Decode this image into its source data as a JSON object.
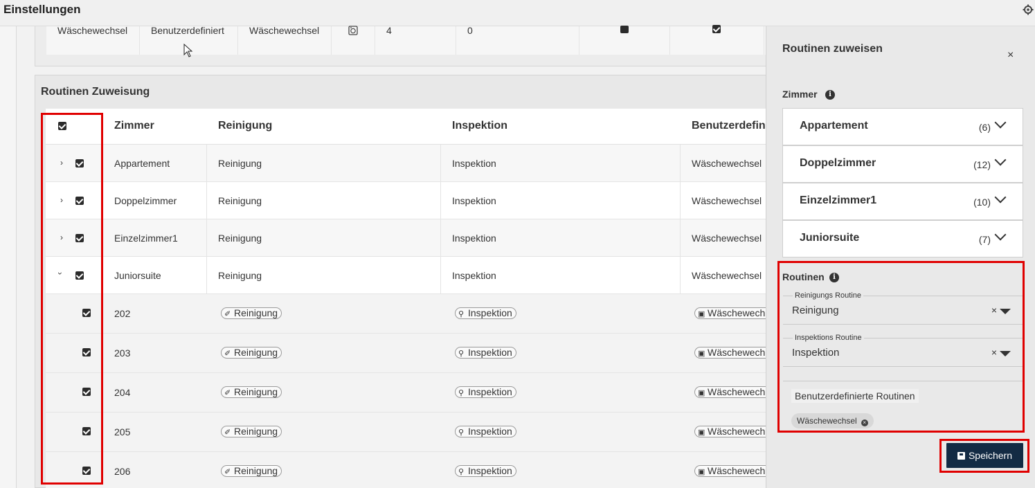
{
  "header": {
    "title": "Einstellungen",
    "settings_icon": "gear-icon"
  },
  "top_row": {
    "cells": [
      "Wäschewechsel",
      "Benutzerdefiniert",
      "Wäschewechsel",
      "4",
      "0"
    ],
    "icon": "laundry-icon"
  },
  "assignment": {
    "title": "Routinen Zuweisung",
    "columns": [
      "Zimmer",
      "Reinigung",
      "Inspektion",
      "Benutzerdefini"
    ],
    "groups": [
      {
        "name": "Appartement",
        "reinigung": "Reinigung",
        "inspektion": "Inspektion",
        "custom": "Wäschewechsel",
        "expanded": false
      },
      {
        "name": "Doppelzimmer",
        "reinigung": "Reinigung",
        "inspektion": "Inspektion",
        "custom": "Wäschewechsel",
        "expanded": false
      },
      {
        "name": "Einzelzimmer1",
        "reinigung": "Reinigung",
        "inspektion": "Inspektion",
        "custom": "Wäschewechsel",
        "expanded": false
      },
      {
        "name": "Juniorsuite",
        "reinigung": "Reinigung",
        "inspektion": "Inspektion",
        "custom": "Wäschewechsel",
        "expanded": true
      }
    ],
    "rooms": [
      {
        "number": "202",
        "reinigung": "Reinigung",
        "inspektion": "Inspektion",
        "custom": "Wäschewech"
      },
      {
        "number": "203",
        "reinigung": "Reinigung",
        "inspektion": "Inspektion",
        "custom": "Wäschewech"
      },
      {
        "number": "204",
        "reinigung": "Reinigung",
        "inspektion": "Inspektion",
        "custom": "Wäschewech"
      },
      {
        "number": "205",
        "reinigung": "Reinigung",
        "inspektion": "Inspektion",
        "custom": "Wäschewech"
      },
      {
        "number": "206",
        "reinigung": "Reinigung",
        "inspektion": "Inspektion",
        "custom": "Wäschewech"
      }
    ]
  },
  "panel": {
    "title": "Routinen zuweisen",
    "close": "×",
    "rooms_label": "Zimmer",
    "room_types": [
      {
        "name": "Appartement",
        "count": "(6)"
      },
      {
        "name": "Doppelzimmer",
        "count": "(12)"
      },
      {
        "name": "Einzelzimmer1",
        "count": "(10)"
      },
      {
        "name": "Juniorsuite",
        "count": "(7)"
      }
    ],
    "routines_label": "Routinen",
    "cleaning": {
      "legend": "Reinigungs Routine",
      "value": "Reinigung",
      "clear": "×"
    },
    "inspection": {
      "legend": "Inspektions Routine",
      "value": "Inspektion",
      "clear": "×"
    },
    "custom": {
      "label": "Benutzerdefinierte Routinen",
      "tag": "Wäschewechsel"
    },
    "save_label": "Speichern"
  },
  "colors": {
    "highlight": "#e00000",
    "save_button": "#132b44"
  }
}
